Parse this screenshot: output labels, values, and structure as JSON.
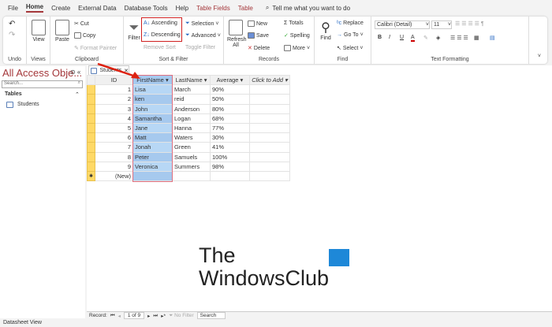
{
  "menu": {
    "items": [
      "File",
      "Home",
      "Create",
      "External Data",
      "Database Tools",
      "Help",
      "Table Fields",
      "Table"
    ],
    "tell_me": "Tell me what you want to do"
  },
  "ribbon": {
    "undo": {
      "label": "Undo"
    },
    "views": {
      "view": "View",
      "label": "Views"
    },
    "clipboard": {
      "paste": "Paste",
      "cut": "Cut",
      "copy": "Copy",
      "format_painter": "Format Painter",
      "label": "Clipboard"
    },
    "sort_filter": {
      "filter": "Filter",
      "ascending": "Ascending",
      "descending": "Descending",
      "remove_sort": "Remove Sort",
      "selection": "Selection",
      "advanced": "Advanced",
      "toggle_filter": "Toggle Filter",
      "label": "Sort & Filter"
    },
    "records": {
      "refresh": "Refresh",
      "refresh_all": "All",
      "new": "New",
      "save": "Save",
      "delete": "Delete",
      "totals": "Totals",
      "spelling": "Spelling",
      "more": "More",
      "label": "Records"
    },
    "find": {
      "find": "Find",
      "replace": "Replace",
      "goto": "Go To",
      "select": "Select",
      "label": "Find"
    },
    "text_formatting": {
      "font": "Calibri (Detail)",
      "size": "11",
      "bold": "B",
      "italic": "I",
      "underline": "U",
      "label": "Text Formatting"
    }
  },
  "nav": {
    "title": "All Access Obje...",
    "search_placeholder": "Search...",
    "section": "Tables",
    "items": [
      "Students"
    ]
  },
  "tab": {
    "label": "Students"
  },
  "table": {
    "columns": [
      "ID",
      "FirstName",
      "LastName",
      "Average",
      "Click to Add"
    ],
    "rows": [
      [
        "1",
        "Lisa",
        "March",
        "90%"
      ],
      [
        "2",
        "ken",
        "reid",
        "50%"
      ],
      [
        "3",
        "John",
        "Anderson",
        "80%"
      ],
      [
        "4",
        "Samantha",
        "Logan",
        "68%"
      ],
      [
        "5",
        "Jane",
        "Hanna",
        "77%"
      ],
      [
        "6",
        "Matt",
        "Waters",
        "30%"
      ],
      [
        "7",
        "Jonah",
        "Green",
        "41%"
      ],
      [
        "8",
        "Peter",
        "Samuels",
        "100%"
      ],
      [
        "9",
        "Veronica",
        "Summers",
        "98%"
      ]
    ],
    "new_row": "(New)"
  },
  "record_nav": {
    "label": "Record:",
    "position": "1 of 9",
    "filter": "No Filter",
    "search": "Search"
  },
  "status": {
    "view": "Datasheet View"
  },
  "watermark": {
    "line1": "The",
    "line2": "WindowsClub"
  }
}
